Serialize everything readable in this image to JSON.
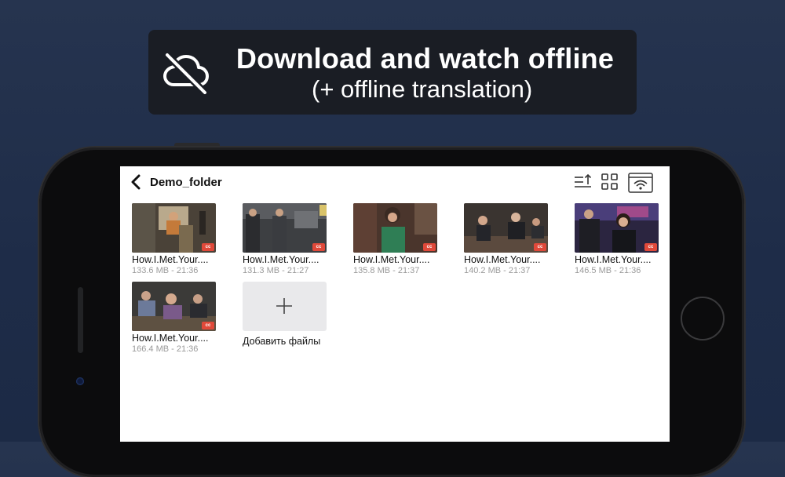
{
  "banner": {
    "icon": "cloud-off-icon",
    "title": "Download and watch offline",
    "subtitle": "(+ offline translation)"
  },
  "screen": {
    "folder_title": "Demo_folder",
    "toolbar": {
      "sort_icon": "sort-icon",
      "grid_icon": "grid-view-icon",
      "wifi_icon": "wifi-transfer-icon"
    },
    "files": [
      {
        "name": "How.I.Met.Your....",
        "meta": "133.6 MB - 21:36",
        "badge": "cc"
      },
      {
        "name": "How.I.Met.Your....",
        "meta": "131.3 MB - 21:27",
        "badge": "cc"
      },
      {
        "name": "How.I.Met.Your....",
        "meta": "135.8 MB - 21:37",
        "badge": "cc"
      },
      {
        "name": "How.I.Met.Your....",
        "meta": "140.2 MB - 21:37",
        "badge": "cc"
      },
      {
        "name": "How.I.Met.Your....",
        "meta": "146.5 MB - 21:36",
        "badge": "cc"
      },
      {
        "name": "How.I.Met.Your....",
        "meta": "166.4 MB - 21:36",
        "badge": "cc"
      }
    ],
    "add_files_label": "Добавить файлы"
  },
  "colors": {
    "background": "#1e2c48",
    "banner": "#1a1d24",
    "cc_badge": "#e0493a"
  }
}
